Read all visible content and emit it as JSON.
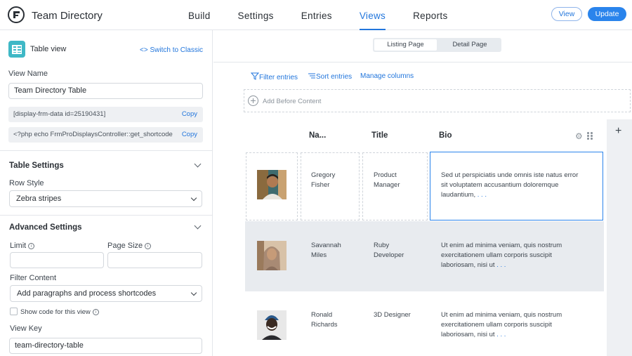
{
  "app": {
    "title": "Team Directory",
    "logo": "formidable-logo-icon"
  },
  "nav": {
    "items": [
      "Build",
      "Settings",
      "Entries",
      "Views",
      "Reports"
    ],
    "active": "Views"
  },
  "header_actions": {
    "view_label": "View",
    "update_label": "Update"
  },
  "sidebar": {
    "view_type": "Table view",
    "switch_link": "<> Switch to Classic",
    "view_name_label": "View Name",
    "view_name_value": "Team Directory Table",
    "shortcode": "[display-frm-data id=25190431]",
    "php_code": "<?php echo FrmProDisplaysController::get_shortcode",
    "copy_label": "Copy",
    "table_settings_title": "Table Settings",
    "row_style_label": "Row Style",
    "row_style_value": "Zebra stripes",
    "advanced_settings_title": "Advanced Settings",
    "limit_label": "Limit",
    "page_size_label": "Page Size",
    "limit_value": "",
    "page_size_value": "",
    "filter_content_label": "Filter Content",
    "filter_content_value": "Add paragraphs and process shortcodes",
    "show_code_label": "Show code for this view",
    "show_code_checked": false,
    "view_key_label": "View Key",
    "view_key_value": "team-directory-table"
  },
  "main": {
    "tabs": [
      "Listing Page",
      "Detail Page"
    ],
    "active_tab": "Listing Page",
    "toolbar": {
      "filter": "Filter entries",
      "sort": "Sort entries",
      "manage": "Manage columns"
    },
    "add_before": "Add Before Content",
    "add_column_symbol": "+",
    "columns": [
      "Na...",
      "Title",
      "Bio"
    ],
    "rows": [
      {
        "first": "Gregory",
        "last": "Fisher",
        "title1": "Product",
        "title2": "Manager",
        "bio1": "Sed ut perspiciatis unde omnis iste natus error",
        "bio2": "sit voluptatem accusantium doloremque",
        "bio3": "laudantium,",
        "ellipsis": ". . .",
        "avatar_colors": [
          "#6b4a36",
          "#c9a271",
          "#3f6b6e"
        ]
      },
      {
        "first": "Savannah",
        "last": "Miles",
        "title1": "Ruby",
        "title2": "Developer",
        "bio1": "Ut enim ad minima veniam, quis nostrum",
        "bio2": "exercitationem ullam corporis suscipit",
        "bio3": "laboriosam, nisi ut",
        "ellipsis": ". . .",
        "avatar_colors": [
          "#b98d6c",
          "#d8c2a8",
          "#9a7a5c"
        ]
      },
      {
        "first": "Ronald",
        "last": "Richards",
        "title1": "3D Designer",
        "title2": "",
        "bio1": "Ut enim ad minima veniam, quis nostrum",
        "bio2": "exercitationem ullam corporis suscipit",
        "bio3": "laboriosam, nisi ut",
        "ellipsis": ". . .",
        "avatar_colors": [
          "#3a2a22",
          "#2b5a8c",
          "#e8e8e8"
        ]
      }
    ]
  },
  "colors": {
    "accent": "#2276dc",
    "button": "#2a84ec",
    "zebra": "#e8ebef",
    "table_icon": "#3fb8c6"
  }
}
